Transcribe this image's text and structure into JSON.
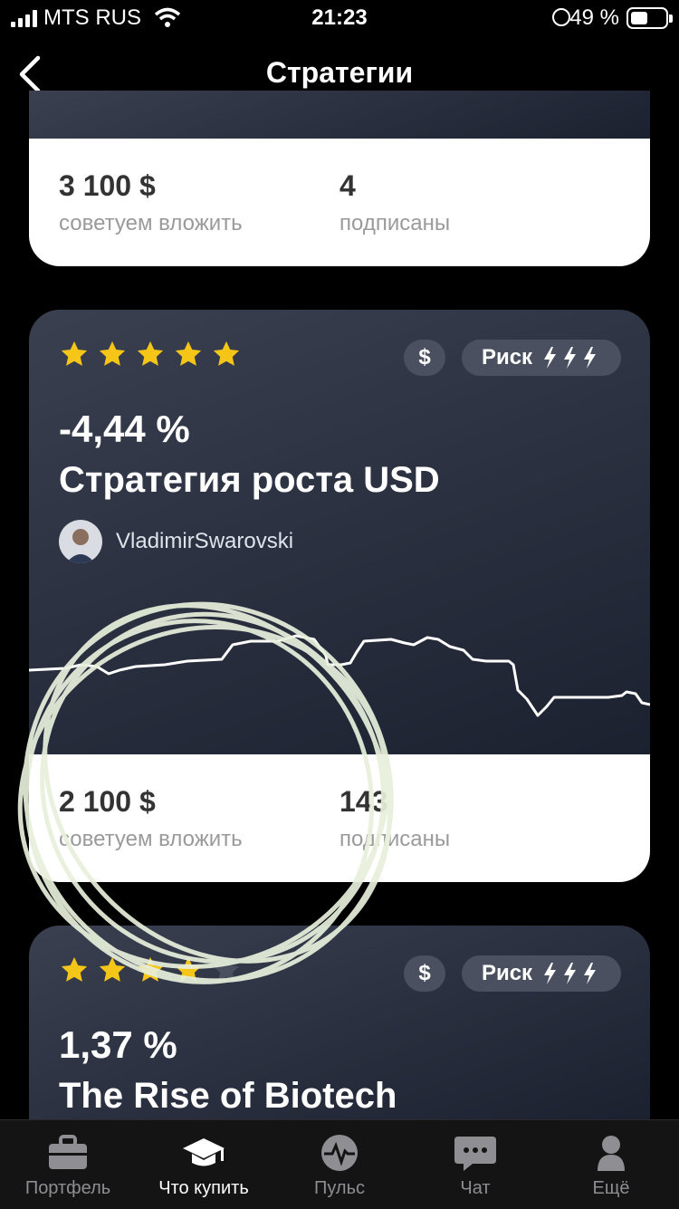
{
  "status": {
    "carrier": "MTS RUS",
    "time": "21:23",
    "battery": "49 %"
  },
  "header": {
    "title": "Стратегии"
  },
  "cards": [
    {
      "recommended": "3 100 $",
      "recommended_label": "советуем вложить",
      "subscribers": "4",
      "subscribers_label": "подписаны"
    },
    {
      "rating": 5,
      "currency_badge": "$",
      "risk_label": "Риск",
      "return": "-4,44 %",
      "name": "Стратегия роста USD",
      "author": "VladimirSwarovski",
      "recommended": "2 100 $",
      "recommended_label": "советуем вложить",
      "subscribers": "143",
      "subscribers_label": "подписаны"
    },
    {
      "rating": 4,
      "currency_badge": "$",
      "risk_label": "Риск",
      "return": "1,37 %",
      "name": "The Rise of Biotech"
    }
  ],
  "tabs": [
    {
      "label": "Портфель",
      "icon": "briefcase-icon"
    },
    {
      "label": "Что купить",
      "icon": "graduation-cap-icon",
      "active": true
    },
    {
      "label": "Пульс",
      "icon": "pulse-icon"
    },
    {
      "label": "Чат",
      "icon": "chat-icon"
    },
    {
      "label": "Ещё",
      "icon": "person-icon"
    }
  ],
  "colors": {
    "background": "#000000",
    "card_dark": "#2a3040",
    "star": "#f5c518",
    "annotation_stroke": "#e8f0dc"
  }
}
